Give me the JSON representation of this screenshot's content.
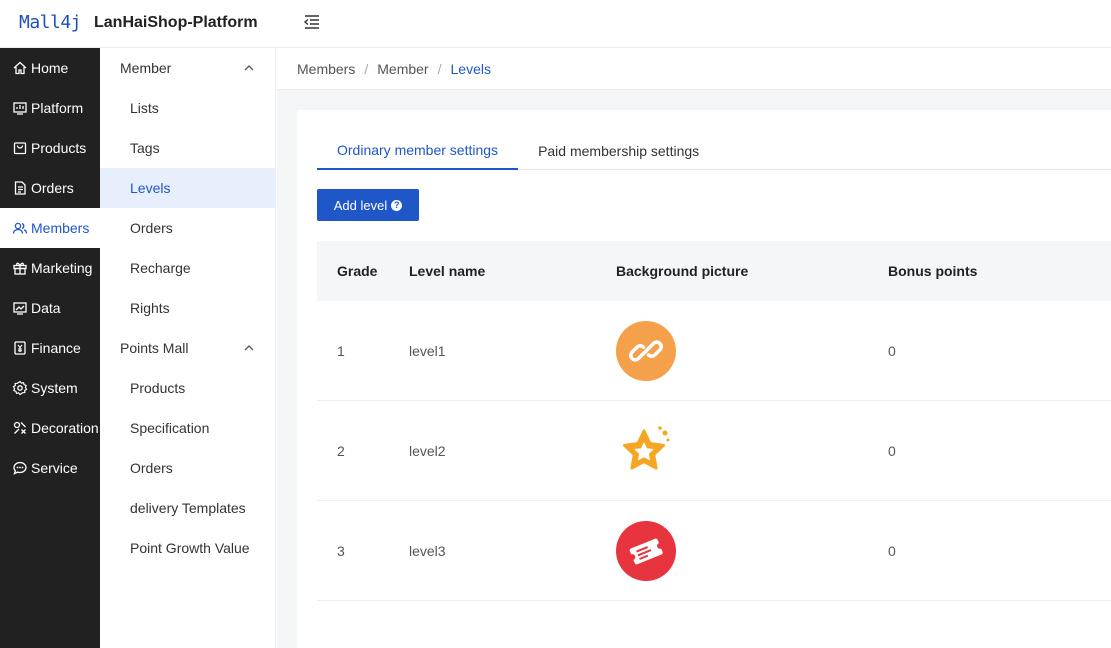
{
  "header": {
    "logo_text": "Mall4j",
    "app_title": "LanHaiShop-Platform"
  },
  "sidebar": {
    "items": [
      {
        "label": "Home",
        "icon": "home-icon"
      },
      {
        "label": "Platform",
        "icon": "platform-icon"
      },
      {
        "label": "Products",
        "icon": "products-icon"
      },
      {
        "label": "Orders",
        "icon": "orders-icon"
      },
      {
        "label": "Members",
        "icon": "members-icon",
        "active": true
      },
      {
        "label": "Marketing",
        "icon": "gift-icon"
      },
      {
        "label": "Data",
        "icon": "chart-icon"
      },
      {
        "label": "Finance",
        "icon": "finance-icon"
      },
      {
        "label": "System",
        "icon": "gear-icon"
      },
      {
        "label": "Decoration",
        "icon": "decoration-icon"
      },
      {
        "label": "Service",
        "icon": "chat-icon"
      }
    ]
  },
  "subnav": {
    "group1": {
      "label": "Member"
    },
    "group1_items": [
      "Lists",
      "Tags",
      "Levels",
      "Orders",
      "Recharge",
      "Rights"
    ],
    "group2": {
      "label": "Points Mall"
    },
    "group2_items": [
      "Products",
      "Specification",
      "Orders",
      "delivery Templates",
      "Point Growth Value"
    ]
  },
  "breadcrumb": {
    "items": [
      "Members",
      "Member",
      "Levels"
    ]
  },
  "tabs": [
    "Ordinary member settings",
    "Paid membership settings"
  ],
  "toolbar": {
    "add_label": "Add level",
    "help_icon": "question-icon"
  },
  "table": {
    "headers": [
      "Grade",
      "Level name",
      "Background picture",
      "Bonus points"
    ],
    "rows": [
      {
        "grade": "1",
        "name": "level1",
        "picture": "link-badge-icon",
        "points": "0"
      },
      {
        "grade": "2",
        "name": "level2",
        "picture": "star-badge-icon",
        "points": "0"
      },
      {
        "grade": "3",
        "name": "level3",
        "picture": "ticket-badge-icon",
        "points": "0"
      }
    ]
  },
  "colors": {
    "accent": "#1f56c8",
    "sidebar_bg": "#212121",
    "badge_orange": "#f5a04a",
    "badge_star": "#f5a623",
    "badge_red": "#e8343f"
  }
}
